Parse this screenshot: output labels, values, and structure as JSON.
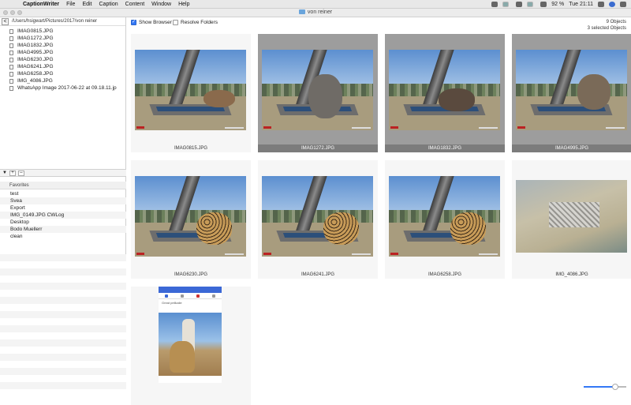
{
  "menubar": {
    "app": "CaptionWriter",
    "items": [
      "File",
      "Edit",
      "Caption",
      "Content",
      "Window",
      "Help"
    ],
    "battery": "92 %",
    "clock": "Tue 21:11"
  },
  "window": {
    "title": "von reiner"
  },
  "left": {
    "path": "/Users/hsigwart/Pictures/2017/von reiner",
    "files": [
      "IMAG0815.JPG",
      "IMAG1272.JPG",
      "IMAG1832.JPG",
      "IMAG4995.JPG",
      "IMAG6230.JPG",
      "IMAG6241.JPG",
      "IMAG6258.JPG",
      "IMG_4086.JPG",
      "WhatsApp Image 2017-06-22 at 09.18.11.jp"
    ],
    "favorites_header": "Favorites",
    "favorites": [
      "test",
      "Svea",
      "Export",
      "IMG_0149.JPG CWLog",
      "Desktop",
      "Bodo Muellerr",
      "clean"
    ]
  },
  "main": {
    "show_browser": "Show Browser",
    "resolve_folders": "Resolve Folders",
    "object_count": "9 Objects",
    "selected_count": "3 selected Objects",
    "images": [
      {
        "name": "IMAG0815.JPG",
        "selected": false,
        "kind": "oryx"
      },
      {
        "name": "IMAG1272.JPG",
        "selected": true,
        "kind": "elephant"
      },
      {
        "name": "IMAG1832.JPG",
        "selected": true,
        "kind": "warthog"
      },
      {
        "name": "IMAG4995.JPG",
        "selected": true,
        "kind": "kudu"
      },
      {
        "name": "IMAG6230.JPG",
        "selected": false,
        "kind": "cheetah"
      },
      {
        "name": "IMAG6241.JPG",
        "selected": false,
        "kind": "cheetah"
      },
      {
        "name": "IMAG6258.JPG",
        "selected": false,
        "kind": "cheetah"
      },
      {
        "name": "IMG_4086.JPG",
        "selected": false,
        "kind": "aerial"
      },
      {
        "name": "",
        "selected": false,
        "kind": "phone"
      }
    ],
    "phone_post_text": "Great pelikalie",
    "zoom_level": 0.75
  }
}
